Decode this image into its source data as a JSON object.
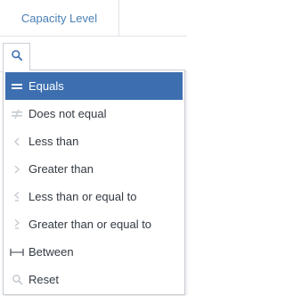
{
  "column": {
    "header_label": "Capacity Level"
  },
  "filter": {
    "button_icon": "search-icon",
    "operators": [
      {
        "label": "Equals",
        "icon": "equals-icon",
        "selected": true
      },
      {
        "label": "Does not equal",
        "icon": "not-equal-icon",
        "selected": false
      },
      {
        "label": "Less than",
        "icon": "less-than-icon",
        "selected": false
      },
      {
        "label": "Greater than",
        "icon": "greater-than-icon",
        "selected": false
      },
      {
        "label": "Less than or equal to",
        "icon": "less-than-or-equal-icon",
        "selected": false
      },
      {
        "label": "Greater than or equal to",
        "icon": "greater-than-or-equal-icon",
        "selected": false
      },
      {
        "label": "Between",
        "icon": "between-icon",
        "selected": false
      },
      {
        "label": "Reset",
        "icon": "reset-search-icon",
        "selected": false
      }
    ]
  },
  "colors": {
    "selected_bg": "#3d6fb0",
    "header_text": "#4a7fb5",
    "icon_gray": "#c5cad0"
  }
}
